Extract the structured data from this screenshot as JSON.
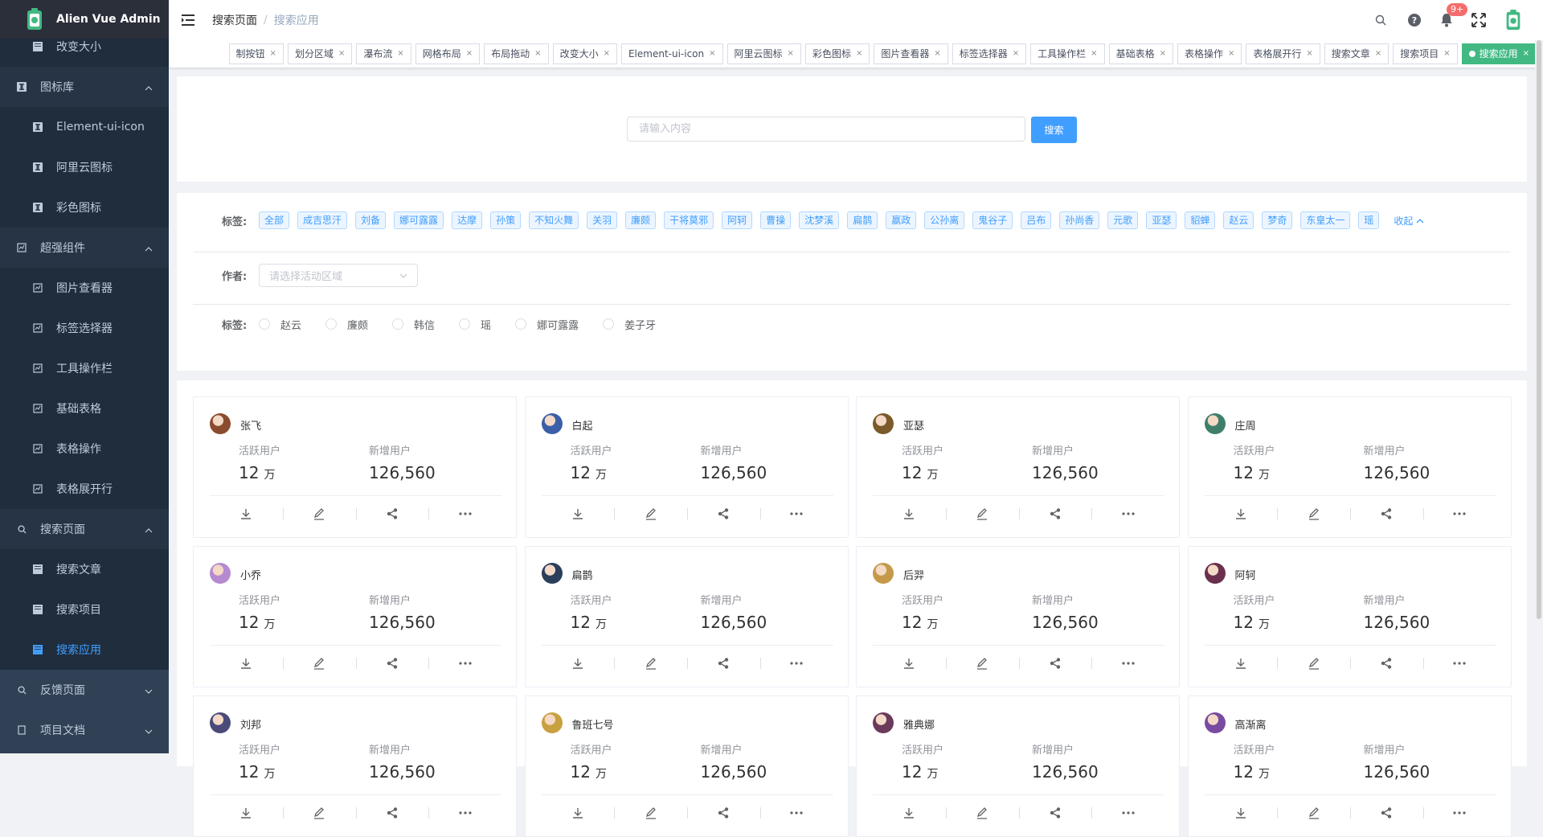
{
  "app": {
    "title": "Alien Vue Admin"
  },
  "colors": {
    "sidebar_bg": "#304156",
    "accent": "#409eff",
    "active_tag": "#42b983",
    "badge": "#f56c6c"
  },
  "sidebar": {
    "items": [
      {
        "label": "改变大小",
        "type": "sub",
        "icon": "folder-icon"
      },
      {
        "label": "图标库",
        "type": "group",
        "icon": "icon-library-icon",
        "expanded": true
      },
      {
        "label": "Element-ui-icon",
        "type": "sub",
        "icon": "icon-library-icon"
      },
      {
        "label": "阿里云图标",
        "type": "sub",
        "icon": "icon-library-icon"
      },
      {
        "label": "彩色图标",
        "type": "sub",
        "icon": "icon-library-icon"
      },
      {
        "label": "超强组件",
        "type": "group",
        "icon": "component-icon",
        "expanded": true
      },
      {
        "label": "图片查看器",
        "type": "sub",
        "icon": "component-icon"
      },
      {
        "label": "标签选择器",
        "type": "sub",
        "icon": "component-icon"
      },
      {
        "label": "工具操作栏",
        "type": "sub",
        "icon": "component-icon"
      },
      {
        "label": "基础表格",
        "type": "sub",
        "icon": "component-icon"
      },
      {
        "label": "表格操作",
        "type": "sub",
        "icon": "component-icon"
      },
      {
        "label": "表格展开行",
        "type": "sub",
        "icon": "component-icon"
      },
      {
        "label": "搜索页面",
        "type": "group",
        "icon": "search-icon",
        "expanded": true
      },
      {
        "label": "搜索文章",
        "type": "sub",
        "icon": "folder-icon"
      },
      {
        "label": "搜索项目",
        "type": "sub",
        "icon": "folder-icon"
      },
      {
        "label": "搜索应用",
        "type": "sub",
        "icon": "folder-icon",
        "active": true
      },
      {
        "label": "反馈页面",
        "type": "group",
        "icon": "search-icon",
        "expanded": false
      },
      {
        "label": "项目文档",
        "type": "group",
        "icon": "document-icon",
        "expanded": false
      }
    ]
  },
  "header": {
    "breadcrumb": [
      "搜索页面",
      "搜索应用"
    ],
    "breadcrumb_sep": "/",
    "notification_count": "9+"
  },
  "tags": [
    {
      "label": "制按钮"
    },
    {
      "label": "划分区域"
    },
    {
      "label": "瀑布流"
    },
    {
      "label": "网格布局"
    },
    {
      "label": "布局拖动"
    },
    {
      "label": "改变大小"
    },
    {
      "label": "Element-ui-icon"
    },
    {
      "label": "阿里云图标"
    },
    {
      "label": "彩色图标"
    },
    {
      "label": "图片查看器"
    },
    {
      "label": "标签选择器"
    },
    {
      "label": "工具操作栏"
    },
    {
      "label": "基础表格"
    },
    {
      "label": "表格操作"
    },
    {
      "label": "表格展开行"
    },
    {
      "label": "搜索文章"
    },
    {
      "label": "搜索项目"
    },
    {
      "label": "搜索应用",
      "active": true
    }
  ],
  "tag_close": "×",
  "search": {
    "placeholder": "请输入内容",
    "button": "搜索"
  },
  "filters": {
    "tags_label": "标签:",
    "tag_chips": [
      "全部",
      "成吉思汗",
      "刘备",
      "娜可露露",
      "达摩",
      "孙策",
      "不知火舞",
      "关羽",
      "廉颇",
      "干将莫邪",
      "阿轲",
      "曹操",
      "沈梦溪",
      "扁鹊",
      "嬴政",
      "公孙离",
      "鬼谷子",
      "吕布",
      "孙尚香",
      "元歌",
      "亚瑟",
      "貂蝉",
      "赵云",
      "梦奇",
      "东皇太一",
      "瑶"
    ],
    "collapse": "收起",
    "author_label": "作者:",
    "author_placeholder": "请选择活动区域",
    "radio_label": "标签:",
    "radio_options": [
      "赵云",
      "廉颇",
      "韩信",
      "瑶",
      "娜可露露",
      "姜子牙"
    ]
  },
  "cards": [
    {
      "name": "张飞",
      "active_label": "活跃用户",
      "active_value": "12",
      "active_unit": "万",
      "new_label": "新增用户",
      "new_value": "126,560",
      "avatar_color": "#8a4b2e"
    },
    {
      "name": "白起",
      "active_label": "活跃用户",
      "active_value": "12",
      "active_unit": "万",
      "new_label": "新增用户",
      "new_value": "126,560",
      "avatar_color": "#3a5fa8"
    },
    {
      "name": "亚瑟",
      "active_label": "活跃用户",
      "active_value": "12",
      "active_unit": "万",
      "new_label": "新增用户",
      "new_value": "126,560",
      "avatar_color": "#7a5a2a"
    },
    {
      "name": "庄周",
      "active_label": "活跃用户",
      "active_value": "12",
      "active_unit": "万",
      "new_label": "新增用户",
      "new_value": "126,560",
      "avatar_color": "#3f7f6a"
    },
    {
      "name": "小乔",
      "active_label": "活跃用户",
      "active_value": "12",
      "active_unit": "万",
      "new_label": "新增用户",
      "new_value": "126,560",
      "avatar_color": "#b68ad0"
    },
    {
      "name": "扁鹊",
      "active_label": "活跃用户",
      "active_value": "12",
      "active_unit": "万",
      "new_label": "新增用户",
      "new_value": "126,560",
      "avatar_color": "#2b3e5a"
    },
    {
      "name": "后羿",
      "active_label": "活跃用户",
      "active_value": "12",
      "active_unit": "万",
      "new_label": "新增用户",
      "new_value": "126,560",
      "avatar_color": "#c49a4a"
    },
    {
      "name": "阿轲",
      "active_label": "活跃用户",
      "active_value": "12",
      "active_unit": "万",
      "new_label": "新增用户",
      "new_value": "126,560",
      "avatar_color": "#6b2f4e"
    },
    {
      "name": "刘邦",
      "active_label": "活跃用户",
      "active_value": "12",
      "active_unit": "万",
      "new_label": "新增用户",
      "new_value": "126,560",
      "avatar_color": "#4a4a7a"
    },
    {
      "name": "鲁班七号",
      "active_label": "活跃用户",
      "active_value": "12",
      "active_unit": "万",
      "new_label": "新增用户",
      "new_value": "126,560",
      "avatar_color": "#c8a040"
    },
    {
      "name": "雅典娜",
      "active_label": "活跃用户",
      "active_value": "12",
      "active_unit": "万",
      "new_label": "新增用户",
      "new_value": "126,560",
      "avatar_color": "#6a3a5a"
    },
    {
      "name": "高渐离",
      "active_label": "活跃用户",
      "active_value": "12",
      "active_unit": "万",
      "new_label": "新增用户",
      "new_value": "126,560",
      "avatar_color": "#7a4aa0"
    }
  ],
  "card_actions": [
    {
      "icon": "download-icon"
    },
    {
      "icon": "edit-icon"
    },
    {
      "icon": "share-icon"
    },
    {
      "icon": "more-icon"
    }
  ]
}
